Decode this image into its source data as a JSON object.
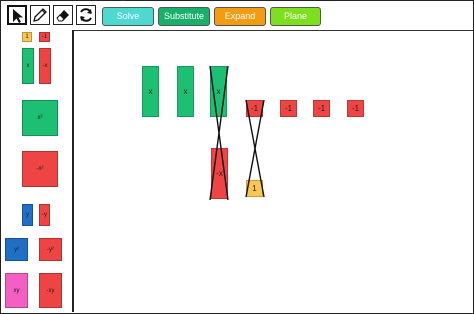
{
  "colors": {
    "green": "#1dbf73",
    "red": "#ef4444",
    "yellow": "#f9c74f",
    "blue": "#1f6fc5",
    "pink": "#f35fc2",
    "solve": "#4dd8d0",
    "substitute": "#19b06b",
    "expand": "#f39c12",
    "plane": "#7ddf1e"
  },
  "tools": [
    {
      "name": "pointer-icon"
    },
    {
      "name": "pencil-icon"
    },
    {
      "name": "eraser-icon"
    },
    {
      "name": "refresh-icon"
    }
  ],
  "buttons": {
    "solve": "Solve",
    "substitute": "Substitute",
    "expand": "Expand",
    "plane": "Plane"
  },
  "palette": {
    "one": "1",
    "neg_one": "-1",
    "x": "x",
    "neg_x": "-x",
    "x2": "x²",
    "neg_x2": "-x²",
    "y": "y",
    "neg_y": "-y",
    "y2": "y²",
    "neg_y2": "-y²",
    "xy": "xy",
    "neg_xy": "-xy"
  },
  "workspace": {
    "x_tiles": [
      "x",
      "x",
      "x"
    ],
    "neg_one_tiles": [
      "-1",
      "-1",
      "-1",
      "-1"
    ],
    "neg_x_tile": "-x",
    "one_tile": "1"
  }
}
